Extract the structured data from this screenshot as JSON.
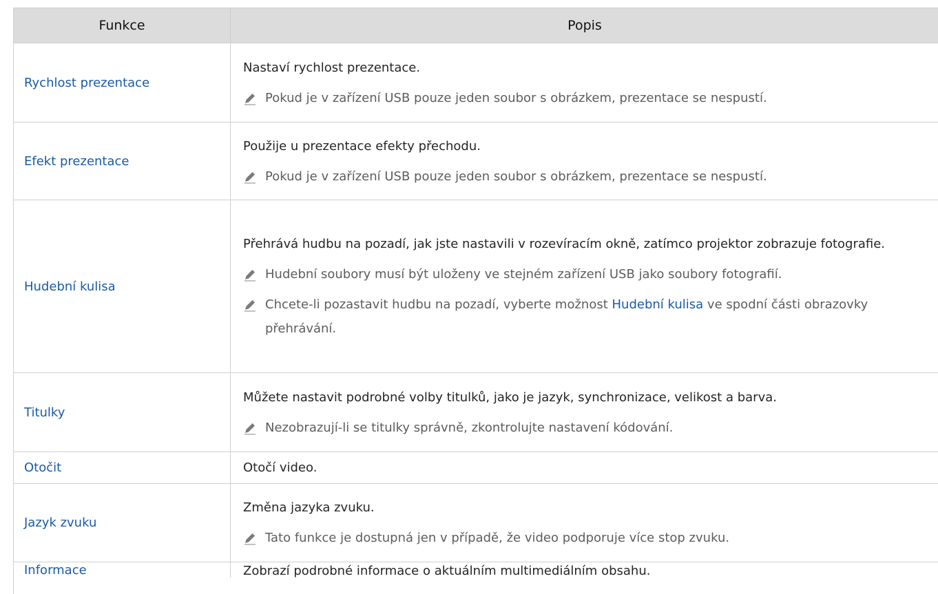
{
  "table": {
    "headers": {
      "feature": "Funkce",
      "description": "Popis"
    },
    "rows": [
      {
        "feature": "Rychlost prezentace",
        "description": "Nastaví rychlost prezentace.",
        "notes": [
          "Pokud je v zařízení USB pouze jeden soubor s obrázkem, prezentace se nespustí."
        ]
      },
      {
        "feature": "Efekt prezentace",
        "description": "Použije u prezentace efekty přechodu.",
        "notes": [
          "Pokud je v zařízení USB pouze jeden soubor s obrázkem, prezentace se nespustí."
        ]
      },
      {
        "feature": "Hudební kulisa",
        "description": "Přehrává hudbu na pozadí, jak jste nastavili v rozevíracím okně, zatímco projektor zobrazuje fotografie.",
        "notes": [
          "Hudební soubory musí být uloženy ve stejném zařízení USB jako soubory fotografií."
        ],
        "note_rich": {
          "before": "Chcete-li pozastavit hudbu na pozadí, vyberte možnost ",
          "highlight": "Hudební kulisa",
          "after": " ve spodní části obrazovky přehrávání."
        }
      },
      {
        "feature": "Titulky",
        "description": "Můžete nastavit podrobné volby titulků, jako je jazyk, synchronizace, velikost a barva.",
        "notes": [
          "Nezobrazují-li se titulky správně, zkontrolujte nastavení kódování."
        ]
      },
      {
        "feature": "Otočit",
        "description": "Otočí video.",
        "notes": []
      },
      {
        "feature": "Jazyk zvuku",
        "description": "Změna jazyka zvuku.",
        "notes": [
          "Tato funkce je dostupná jen v případě, že video podporuje více stop zvuku."
        ]
      },
      {
        "feature": "Informace",
        "description": "Zobrazí podrobné informace o aktuálním multimediálním obsahu.",
        "notes": []
      }
    ]
  },
  "icons": {
    "note": "pencil-icon"
  },
  "colors": {
    "link": "#1a5aa8",
    "header_bg": "#dcdcdc",
    "note_text": "#5d5d5d",
    "border": "#cfcfcf"
  }
}
